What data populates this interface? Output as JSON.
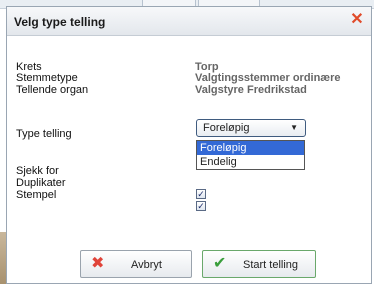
{
  "dialog": {
    "title": "Velg type telling",
    "close_icon": "close-icon",
    "accent_close": "#e04b2a"
  },
  "info": {
    "krets_label": "Krets",
    "krets_value": "Torp",
    "stemmetype_label": "Stemmetype",
    "stemmetype_value": "Valgtingsstemmer ordinære",
    "tellende_label": "Tellende organ",
    "tellende_value": "Valgstyre Fredrikstad"
  },
  "type_telling": {
    "label": "Type telling",
    "selected": "Foreløpig",
    "options": [
      "Foreløpig",
      "Endelig"
    ]
  },
  "sjekk": {
    "heading": "Sjekk for",
    "duplikater_label": "Duplikater",
    "duplikater_checked": true,
    "stempel_label": "Stempel",
    "stempel_checked": true
  },
  "buttons": {
    "cancel_label": "Avbryt",
    "cancel_icon": "cross-icon",
    "start_label": "Start telling",
    "start_icon": "checkmark-icon"
  }
}
